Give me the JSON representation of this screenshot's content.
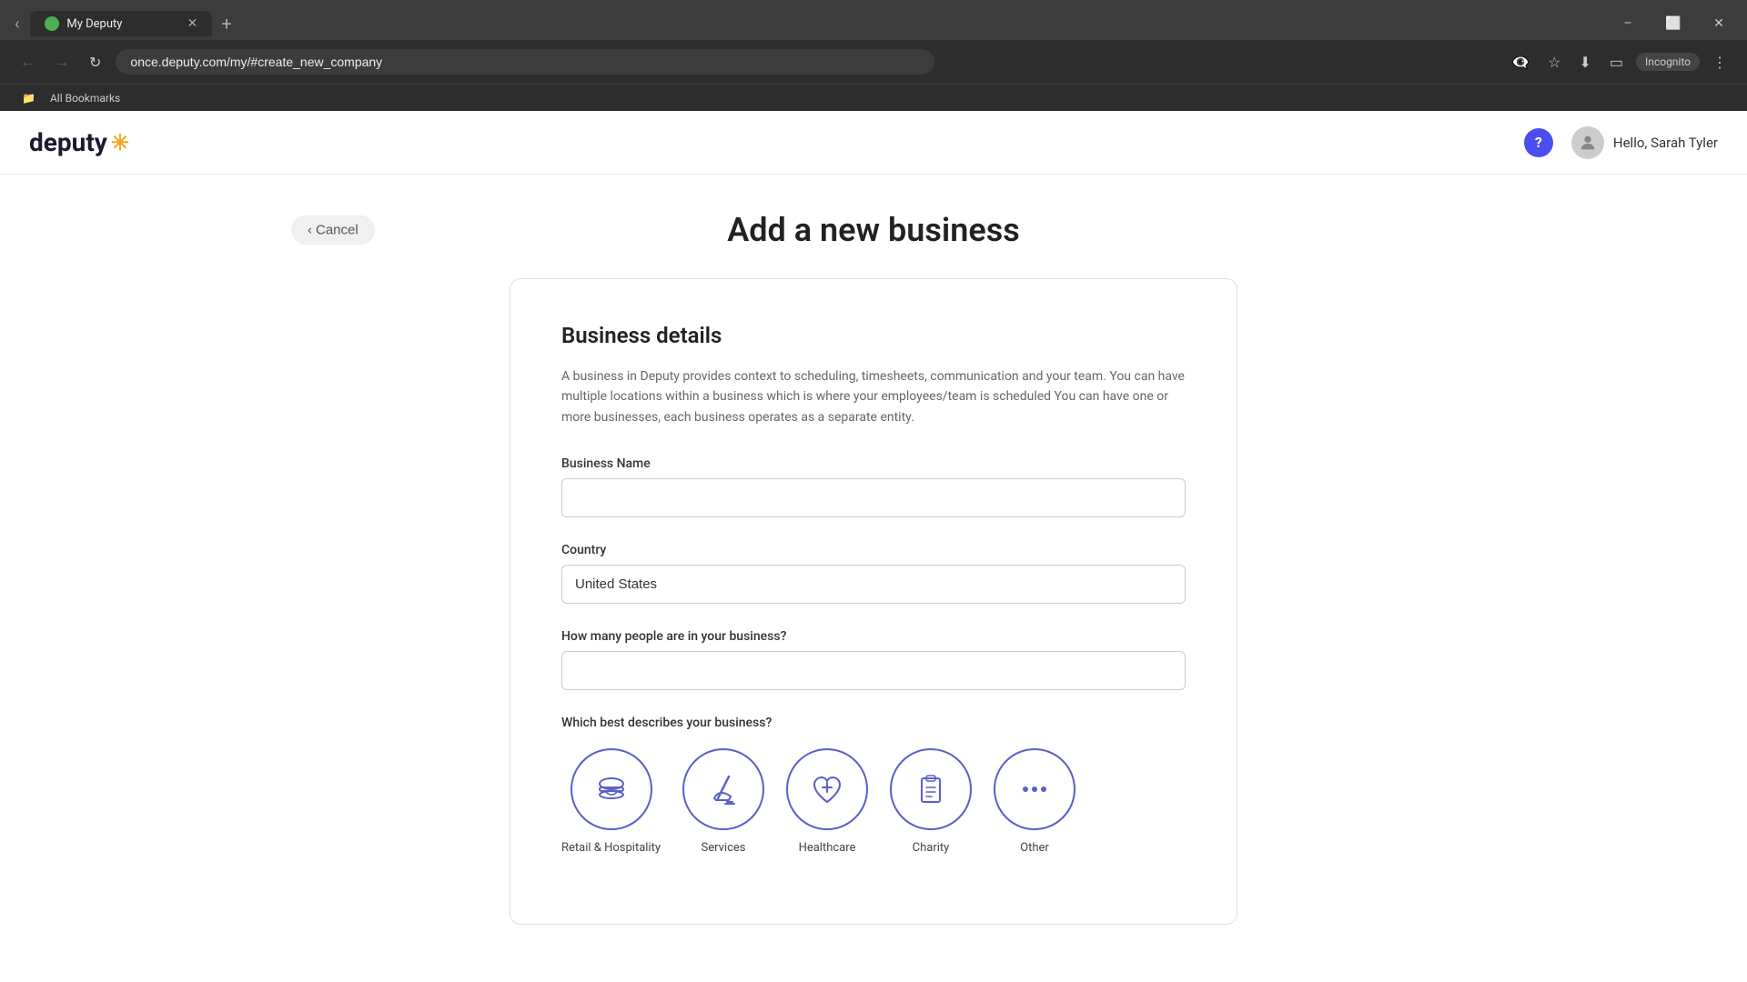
{
  "browser": {
    "tab_label": "My Deputy",
    "url": "once.deputy.com/my/#create_new_company",
    "new_tab_label": "+",
    "incognito_label": "Incognito",
    "bookmarks_label": "All Bookmarks",
    "nav_back": "‹",
    "nav_forward": "›",
    "nav_reload": "↺"
  },
  "window_controls": {
    "minimize": "–",
    "maximize": "⬜",
    "close": "✕"
  },
  "header": {
    "logo_text": "deputy",
    "logo_star": "✳",
    "help_label": "?",
    "user_greeting": "Hello, Sarah Tyler"
  },
  "page": {
    "title": "Add a new business",
    "cancel_label": "Cancel",
    "cancel_icon": "‹"
  },
  "form": {
    "section_title": "Business details",
    "description": "A business in Deputy provides context to scheduling, timesheets, communication and your team. You can have multiple locations within a business which is where your employees/team is scheduled You can have one or more businesses, each business operates as a separate entity.",
    "business_name_label": "Business Name",
    "business_name_placeholder": "",
    "country_label": "Country",
    "country_value": "United States",
    "people_count_label": "How many people are in your business?",
    "people_count_placeholder": "",
    "business_type_label": "Which best describes your business?",
    "business_types": [
      {
        "id": "retail-hospitality",
        "name": "Retail & Hospitality",
        "icon": "🍔"
      },
      {
        "id": "services",
        "name": "Services",
        "icon": "🧹"
      },
      {
        "id": "healthcare",
        "name": "Healthcare",
        "icon": "🏥"
      },
      {
        "id": "charity",
        "name": "Charity",
        "icon": "📋"
      },
      {
        "id": "other",
        "name": "Other",
        "icon": "···"
      }
    ]
  }
}
